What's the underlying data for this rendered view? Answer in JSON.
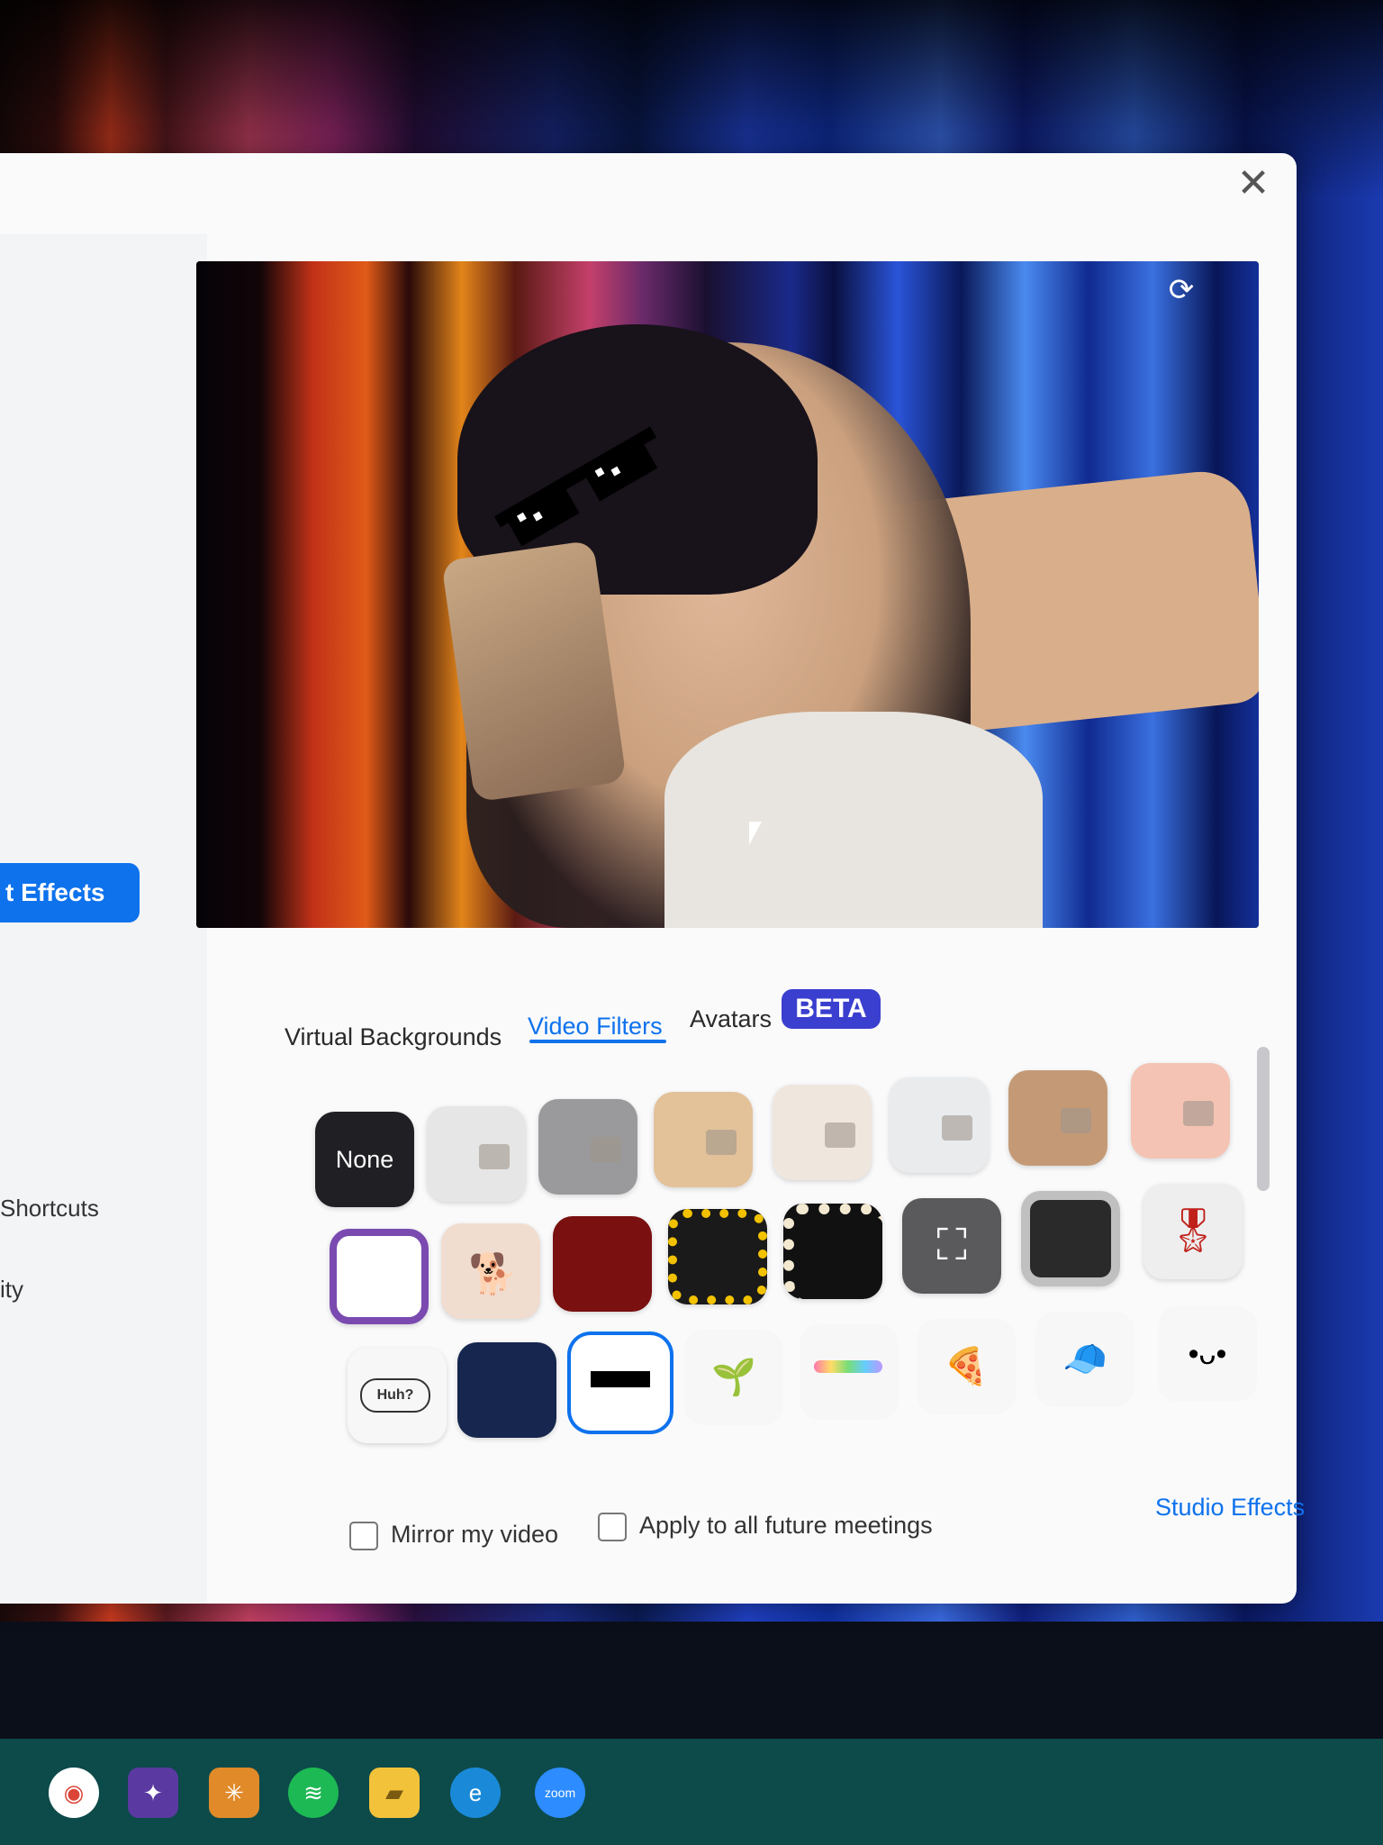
{
  "sidebar": {
    "active_label": "t Effects",
    "items": [
      {
        "label": "Shortcuts"
      },
      {
        "label": "ity"
      }
    ],
    "accent": "#0e72ed"
  },
  "dialog": {
    "close_icon": "close-icon"
  },
  "tabs": [
    {
      "label": "Virtual Backgrounds",
      "active": false
    },
    {
      "label": "Video Filters",
      "active": true
    },
    {
      "label": "Avatars",
      "active": false
    }
  ],
  "beta_badge": "BETA",
  "filters": {
    "none_label": "None",
    "speech_bubble_label": "Huh?",
    "selected": "pixel-sunglasses"
  },
  "options": {
    "mirror_label": "Mirror my video",
    "apply_future_label": "Apply to all future meetings"
  },
  "studio_effects": "Studio Effects",
  "taskbar": [
    "chrome-icon",
    "photos-icon",
    "spotify-icon",
    "file-explorer-icon",
    "edge-icon",
    "zoom-icon"
  ]
}
